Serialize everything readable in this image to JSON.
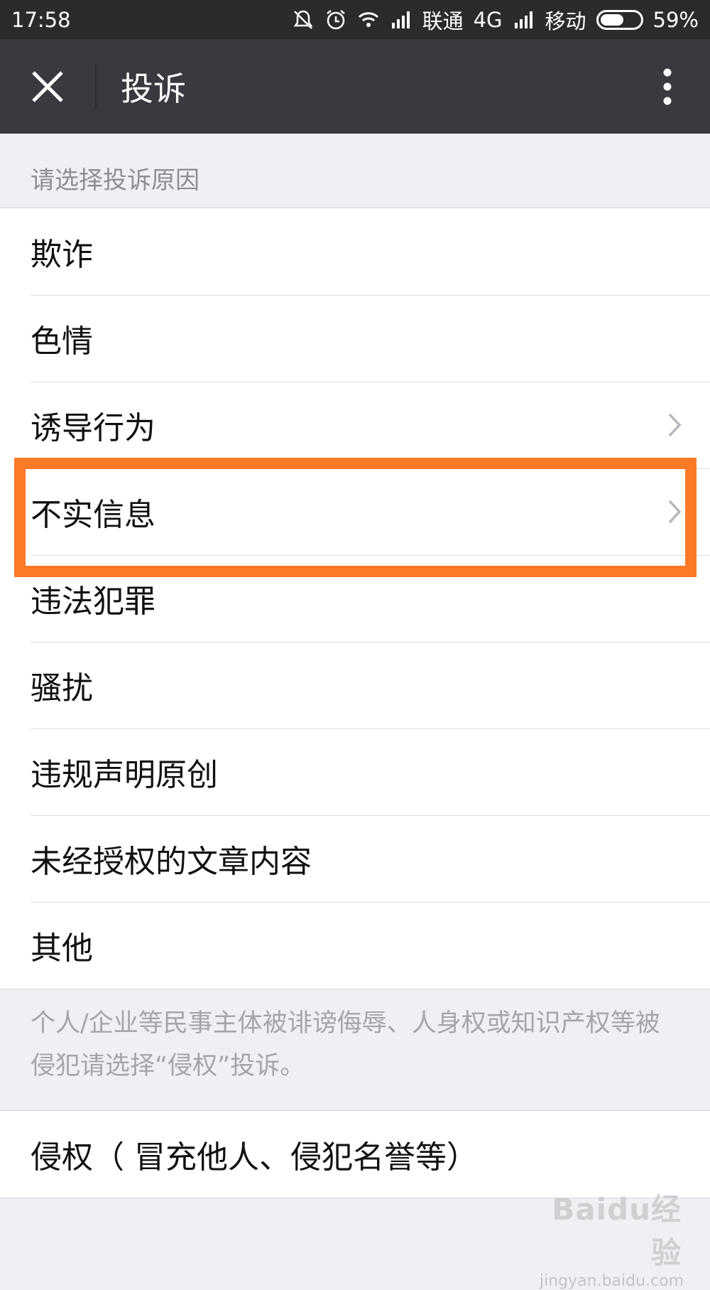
{
  "status_bar": {
    "time": "17:58",
    "carrier1": "联通",
    "network": "4G",
    "carrier2": "移动",
    "battery": "59%",
    "battery_level": 0.59,
    "icons": [
      "mute-icon",
      "alarm-icon",
      "wifi-icon",
      "signal-icon"
    ]
  },
  "header": {
    "title": "投诉",
    "close_icon": "close-icon",
    "more_icon": "more-vertical-icon"
  },
  "section_title": "请选择投诉原因",
  "reasons": [
    {
      "label": "欺诈",
      "has_arrow": false
    },
    {
      "label": "色情",
      "has_arrow": false
    },
    {
      "label": "诱导行为",
      "has_arrow": true
    },
    {
      "label": "不实信息",
      "has_arrow": true
    },
    {
      "label": "违法犯罪",
      "has_arrow": false
    },
    {
      "label": "骚扰",
      "has_arrow": false
    },
    {
      "label": "违规声明原创",
      "has_arrow": false
    },
    {
      "label": "未经授权的文章内容",
      "has_arrow": false
    },
    {
      "label": "其他",
      "has_arrow": false
    }
  ],
  "note": "个人/企业等民事主体被诽谤侮辱、人身权或知识产权等被侵犯请选择“侵权”投诉。",
  "infringement_item": "侵权（ 冒充他人、侵犯名誉等）",
  "watermark": {
    "logo": "Baidu经验",
    "url": "jingyan.baidu.com"
  },
  "colors": {
    "highlight": "#ff7a26",
    "title_bar": "#393a3f",
    "status_bar": "#2b2b2e"
  }
}
